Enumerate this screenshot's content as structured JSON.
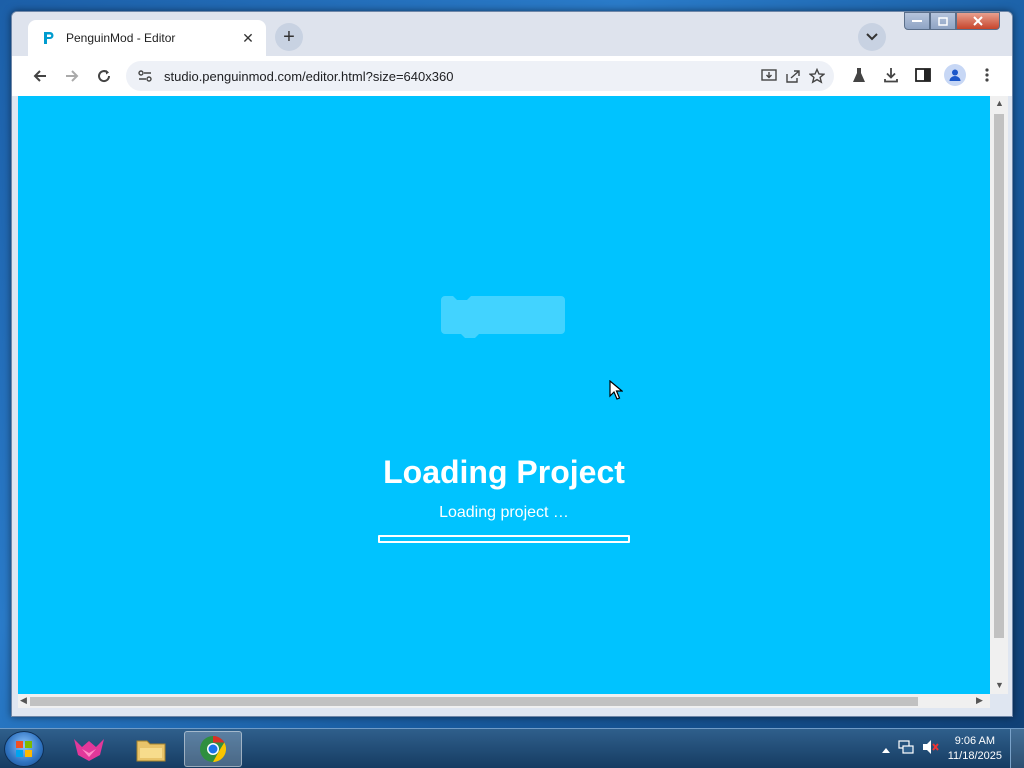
{
  "browser": {
    "tab_title": "PenguinMod - Editor",
    "new_tab_symbol": "+",
    "close_symbol": "✕",
    "url": "studio.penguinmod.com/editor.html?size=640x360"
  },
  "page": {
    "loading_title": "Loading Project",
    "loading_subtitle": "Loading project …",
    "progress": 0.0,
    "background_color": "#00c3ff"
  },
  "taskbar": {
    "time": "9:06 AM",
    "date": "11/18/2025"
  },
  "icons": {
    "window": [
      "minimize-icon",
      "maximize-icon",
      "close-icon"
    ],
    "toolbar": [
      "back-icon",
      "forward-icon",
      "reload-icon",
      "site-info-icon",
      "install-app-icon",
      "share-icon",
      "bookmark-star-icon",
      "labs-icon",
      "download-icon",
      "side-panel-icon",
      "profile-icon",
      "menu-icon"
    ],
    "taskbar": [
      "start-orb-icon",
      "pink-fox-app-icon",
      "file-explorer-icon",
      "chrome-icon",
      "tray-arrow-icon",
      "network-icon",
      "volume-muted-icon"
    ]
  }
}
